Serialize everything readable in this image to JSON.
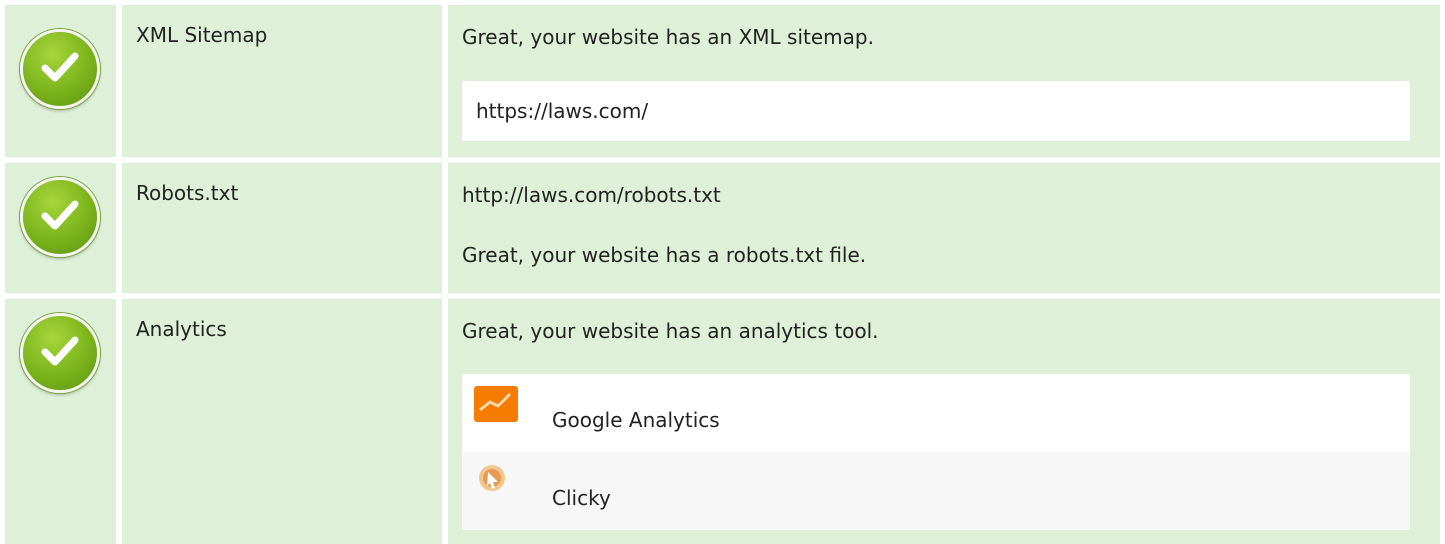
{
  "rows": [
    {
      "name": "XML Sitemap",
      "status_icon": "check-icon",
      "message": "Great, your website has an XML sitemap.",
      "detail": "https://laws.com/"
    },
    {
      "name": "Robots.txt",
      "status_icon": "check-icon",
      "url": "http://laws.com/robots.txt",
      "message": "Great, your website has a robots.txt file."
    },
    {
      "name": "Analytics",
      "status_icon": "check-icon",
      "message": "Great, your website has an analytics tool.",
      "tools": [
        {
          "name": "Google Analytics",
          "icon": "google-analytics-icon"
        },
        {
          "name": "Clicky",
          "icon": "clicky-icon"
        }
      ]
    }
  ],
  "colors": {
    "row_background": "#dff0d8",
    "check_green": "#7bb31c",
    "ga_orange": "#f57c00"
  }
}
